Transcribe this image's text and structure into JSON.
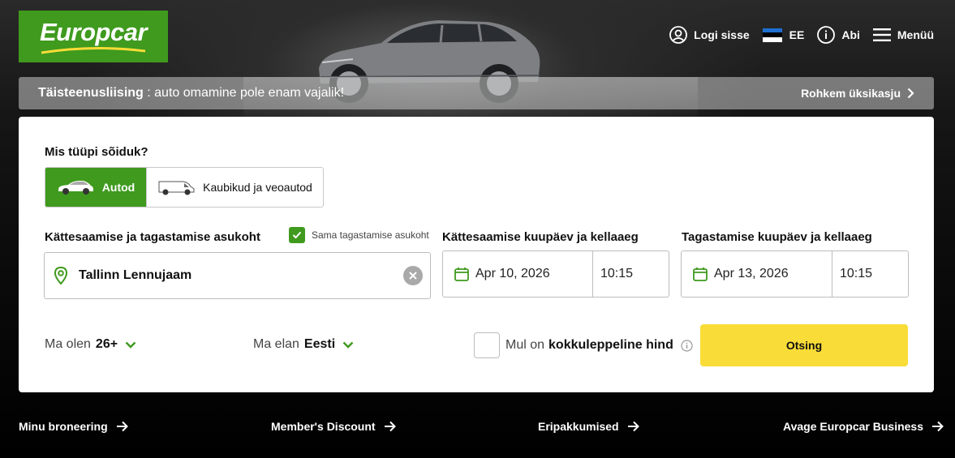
{
  "brand": {
    "name": "Europcar",
    "color_green": "#3f9a1e",
    "color_yellow": "#f9dc37"
  },
  "nav": {
    "login": {
      "label": "Logi sisse",
      "icon": "user-circle-icon"
    },
    "language": {
      "label": "EE",
      "icon": "estonia-flag-icon"
    },
    "help": {
      "label": "Abi",
      "icon": "info-icon"
    },
    "menu": {
      "label": "Menüü",
      "icon": "hamburger-icon"
    }
  },
  "promo": {
    "title": "Täisteenusliising",
    "text": " : auto omamine pole enam vajalik!",
    "link": "Rohkem üksikasju"
  },
  "booking": {
    "vehicle_type_label": "Mis tüüpi sõiduk?",
    "vehicle_options": [
      {
        "label": "Autod",
        "icon": "car-icon",
        "selected": true
      },
      {
        "label": "Kaubikud ja veoautod",
        "icon": "van-icon",
        "selected": false
      }
    ],
    "location_label": "Kättesaamise ja tagastamise asukoht",
    "same_location_label": "Sama tagastamise asukoht",
    "same_location_checked": true,
    "location_value": "Tallinn Lennujaam",
    "pickup_label": "Kättesaamise kuupäev ja kellaaeg",
    "pickup_date": "Apr 10, 2026",
    "pickup_time": "10:15",
    "return_label": "Tagastamise kuupäev ja kellaaeg",
    "return_date": "Apr 13, 2026",
    "return_time": "10:15",
    "age_prefix": "Ma olen",
    "age_value": "26+",
    "residence_prefix": "Ma elan",
    "residence_value": "Eesti",
    "negotiated_prefix": "Mul on",
    "negotiated_bold": "kokkuleppeline hind",
    "search_label": "Otsing"
  },
  "footer_links": [
    {
      "label": "Minu broneering"
    },
    {
      "label": "Member's Discount"
    },
    {
      "label": "Eripakkumised"
    },
    {
      "label": "Avage Europcar Business"
    }
  ]
}
